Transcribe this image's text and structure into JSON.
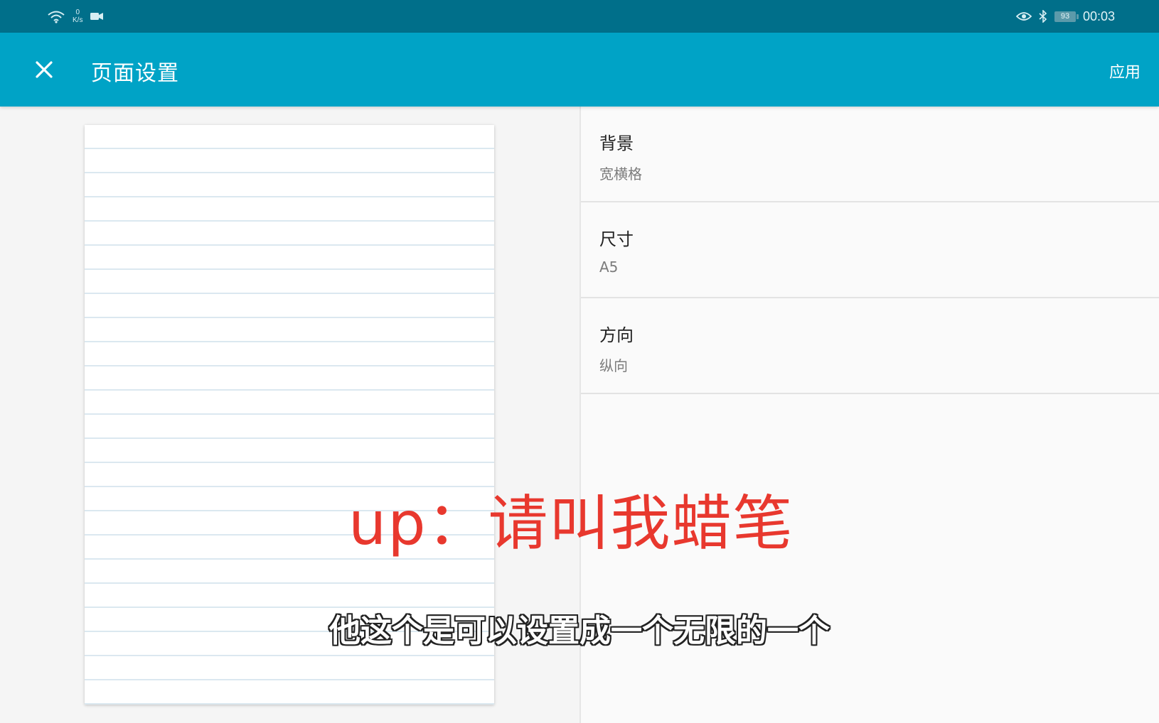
{
  "status_bar": {
    "net_speed_value": "0",
    "net_speed_unit": "K/s",
    "battery": "93",
    "time": "00:03",
    "icons": [
      "wifi-icon",
      "video-record-icon",
      "eye-comfort-icon",
      "bluetooth-icon",
      "battery-icon"
    ]
  },
  "app_bar": {
    "close_icon": "close-icon",
    "title": "页面设置",
    "apply_label": "应用"
  },
  "settings": {
    "items": [
      {
        "label": "背景",
        "value": "宽横格"
      },
      {
        "label": "尺寸",
        "value": "A5"
      },
      {
        "label": "方向",
        "value": "纵向"
      }
    ]
  },
  "preview": {
    "style": "wide-ruled"
  },
  "overlay": {
    "watermark": "up：请叫我蜡笔",
    "subtitle": "他这个是可以设置成一个无限的一个"
  },
  "colors": {
    "status_bar": "#006f8a",
    "app_bar": "#00a3c6",
    "watermark": "#e8382e",
    "ruled_line": "#dbe8f0"
  }
}
